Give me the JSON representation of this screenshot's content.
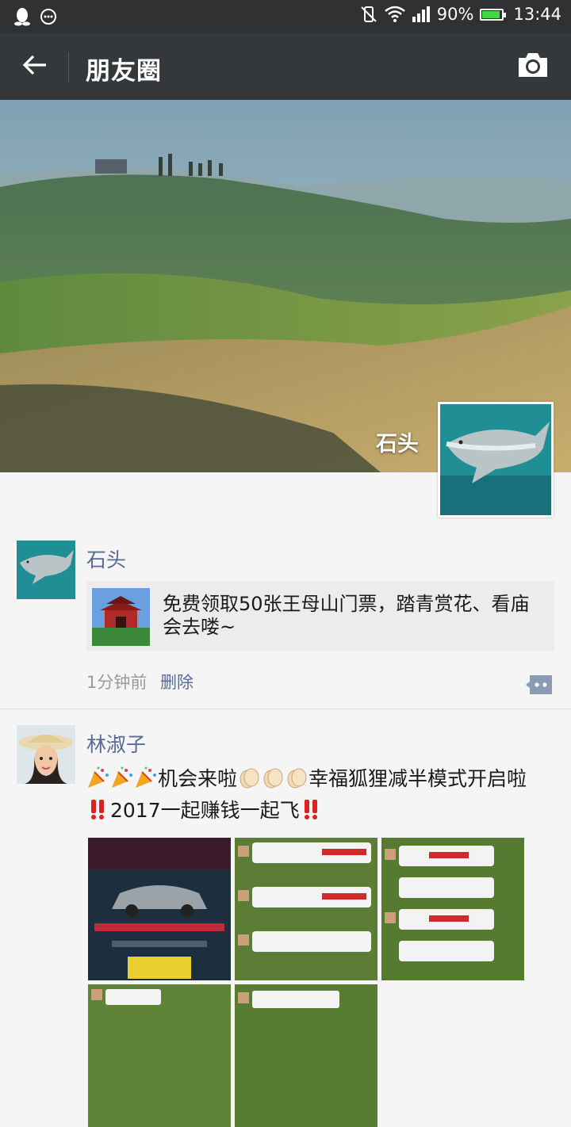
{
  "status_bar": {
    "battery_percent": "90%",
    "time": "13:44",
    "left_icons": [
      "qq-icon",
      "message-icon"
    ],
    "right_icons": [
      "vibrate-icon",
      "wifi-icon",
      "signal-icon",
      "battery-icon"
    ]
  },
  "header": {
    "title": "朋友圈",
    "back_icon": "back-arrow-icon",
    "camera_icon": "camera-icon"
  },
  "cover": {
    "user_name": "石头"
  },
  "posts": [
    {
      "author": "石头",
      "share": {
        "text": "免费领取50张王母山门票，踏青赏花、看庙会去喽~"
      },
      "time": "1分钟前",
      "delete_label": "删除"
    },
    {
      "author": "林淑子",
      "text_1": "机会来啦",
      "text_2": "幸福狐狸减半模式开启啦",
      "text_3": "2017一起赚钱一起飞",
      "emoji_party": "party-popper-icon",
      "emoji_clap": "clapping-hands-icon",
      "emoji_exclaim": "double-exclamation-icon"
    }
  ],
  "colors": {
    "link": "#576b95",
    "actionbar": "#35383b",
    "statusbar": "#2f3133"
  }
}
